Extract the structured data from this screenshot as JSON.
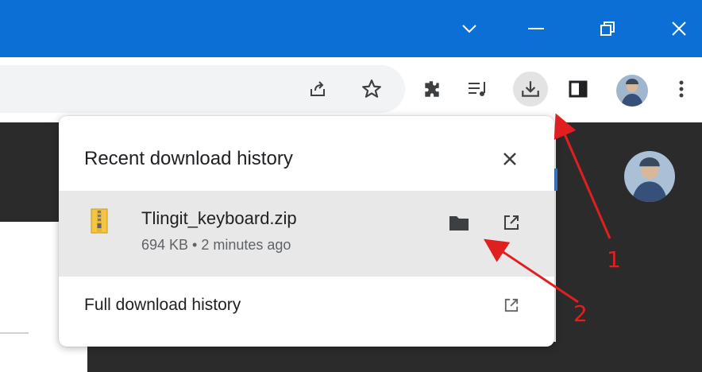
{
  "window": {
    "controls": [
      "tab-search",
      "minimize",
      "restore",
      "close"
    ]
  },
  "toolbar": {
    "icons": [
      "share-icon",
      "bookmark-star-icon",
      "extensions-icon",
      "reading-list-icon",
      "download-icon",
      "side-panel-icon",
      "profile-avatar",
      "more-menu-icon"
    ]
  },
  "popup": {
    "title": "Recent download history",
    "item": {
      "filename": "Tlingit_keyboard.zip",
      "meta": "694 KB • 2 minutes ago"
    },
    "full_history_label": "Full download history"
  },
  "annotations": {
    "label_1": "1",
    "label_2": "2",
    "color": "#e02020"
  },
  "colors": {
    "titlebar": "#0b6fd6",
    "dark_page": "#2b2b2b",
    "row_highlight": "#e8e8e8"
  }
}
